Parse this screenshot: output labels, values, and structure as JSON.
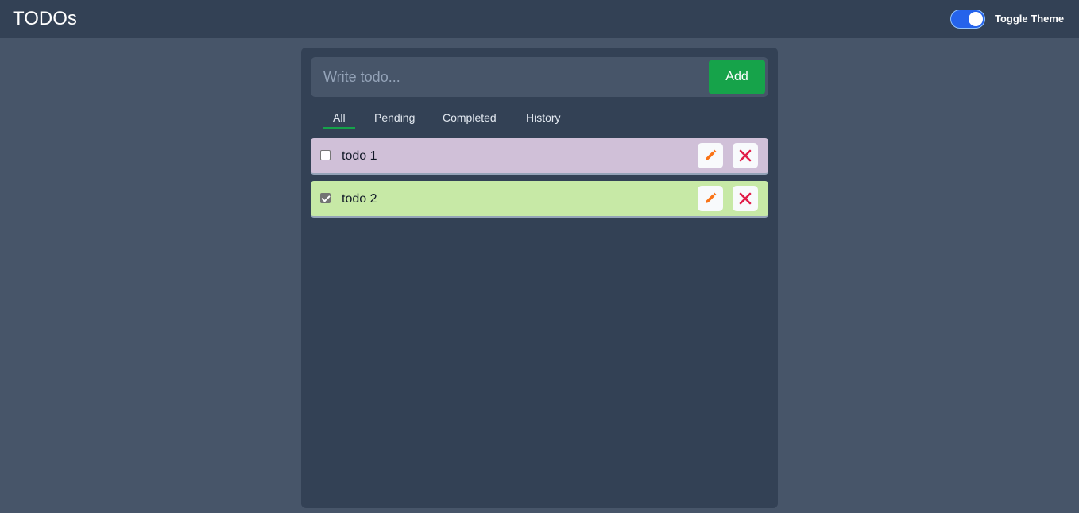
{
  "header": {
    "title": "TODOs",
    "toggle_label": "Toggle Theme",
    "toggle_on": true
  },
  "input": {
    "placeholder": "Write todo...",
    "value": "",
    "add_label": "Add"
  },
  "tabs": [
    {
      "label": "All",
      "active": true
    },
    {
      "label": "Pending",
      "active": false
    },
    {
      "label": "Completed",
      "active": false
    },
    {
      "label": "History",
      "active": false
    }
  ],
  "todos": [
    {
      "text": "todo 1",
      "completed": false,
      "color": "#d0c0d8"
    },
    {
      "text": "todo 2",
      "completed": true,
      "color": "#c7e9a6"
    }
  ],
  "icons": {
    "edit": "pencil-icon",
    "delete": "close-icon"
  },
  "colors": {
    "accent": "#16a34a",
    "toggle": "#2563eb",
    "edit_icon": "#f97316",
    "delete_icon": "#e11d48"
  }
}
